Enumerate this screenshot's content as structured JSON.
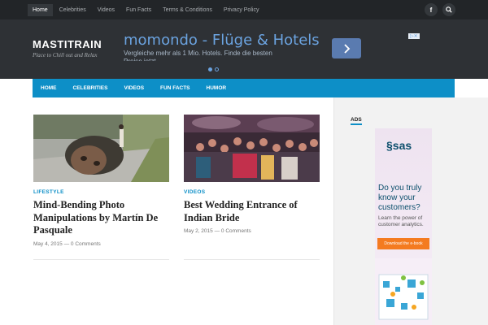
{
  "topnav": {
    "items": [
      "Home",
      "Celebrities",
      "Videos",
      "Fun Facts",
      "Terms & Conditions",
      "Privacy Policy"
    ],
    "social_icon": "facebook-icon",
    "search_icon": "search-icon"
  },
  "header": {
    "logo": "MASTITRAIN",
    "tagline": "Place to Chill out and Relax"
  },
  "ad": {
    "title": "momondo - Flüge & Hotels",
    "description": "Vergleiche mehr als 1 Mio. Hotels. Finde die besten",
    "description_cont": "Preise jetzt",
    "next_icon": "chevron-right-icon"
  },
  "mainnav": {
    "items": [
      "HOME",
      "CELEBRITIES",
      "VIDEOS",
      "FUN FACTS",
      "HUMOR"
    ]
  },
  "posts": [
    {
      "category": "LIFESTYLE",
      "title": "Mind-Bending Photo Manipulations by Martín De Pasquale",
      "date": "May 4, 2015",
      "comments": "0 Comments"
    },
    {
      "category": "VIDEOS",
      "title": "Best Wedding Entrance of Indian Bride",
      "date": "May 2, 2015",
      "comments": "0 Comments"
    }
  ],
  "sidebar": {
    "label": "ADS",
    "sas": {
      "logo": "sas",
      "headline": "Do you truly know your customers?",
      "sub": "Learn the power of customer analytics.",
      "button": "Download the e-book"
    }
  },
  "colors": {
    "accent": "#0d8fc7",
    "topbar": "#222528",
    "header": "#2e3135"
  }
}
